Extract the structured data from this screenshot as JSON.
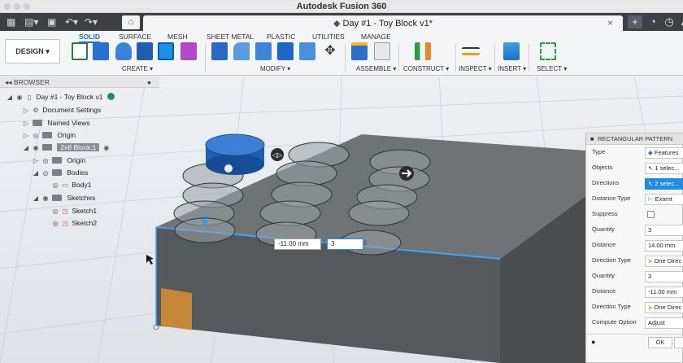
{
  "app_title": "Autodesk Fusion 360",
  "document_tab": {
    "title": "Day #1 - Toy Block v1*"
  },
  "ribbon": {
    "workspace_label": "DESIGN",
    "tabs": [
      "SOLID",
      "SURFACE",
      "MESH",
      "SHEET METAL",
      "PLASTIC",
      "UTILITIES",
      "MANAGE"
    ],
    "active_tab": "SOLID",
    "groups": [
      "CREATE",
      "MODIFY",
      "ASSEMBLE",
      "CONSTRUCT",
      "INSPECT",
      "INSERT",
      "SELECT"
    ]
  },
  "browser": {
    "header": "BROWSER",
    "items": [
      {
        "label": "Day #1 - Toy Block v1"
      },
      {
        "label": "Document Settings"
      },
      {
        "label": "Named Views"
      },
      {
        "label": "Origin"
      },
      {
        "label": "2x8 Block:1"
      },
      {
        "label": "Origin"
      },
      {
        "label": "Bodies"
      },
      {
        "label": "Body1"
      },
      {
        "label": "Sketches"
      },
      {
        "label": "Sketch1"
      },
      {
        "label": "Sketch2"
      }
    ]
  },
  "viewport": {
    "distance_input": "-11.00 mm",
    "quantity_input": "3"
  },
  "pattern_panel": {
    "title": "RECTANGULAR PATTERN",
    "rows": [
      {
        "label": "Type",
        "value": "Features"
      },
      {
        "label": "Objects",
        "value": "1 selec..."
      },
      {
        "label": "Directions",
        "value": "2 selec..."
      },
      {
        "label": "Distance Type",
        "value": "Extent"
      },
      {
        "label": "Suppress",
        "value": ""
      },
      {
        "label": "Quantity",
        "value": "3"
      },
      {
        "label": "Distance",
        "value": "14.00 mm"
      },
      {
        "label": "Direction Type",
        "value": "One Direc"
      },
      {
        "label": "Quantity",
        "value": "3"
      },
      {
        "label": "Distance",
        "value": "-11.00 mm"
      },
      {
        "label": "Direction Type",
        "value": "One Direc"
      },
      {
        "label": "Compute Option",
        "value": "Adjust"
      }
    ],
    "ok_label": "OK"
  },
  "colors": {
    "accent": "#1e6fc6",
    "selection": "#1f8ce6",
    "block_top": "#6b6f72",
    "block_front": "#4f5356",
    "stud_blue": "#1e5fb8",
    "orange_plane": "#e89a2c"
  }
}
